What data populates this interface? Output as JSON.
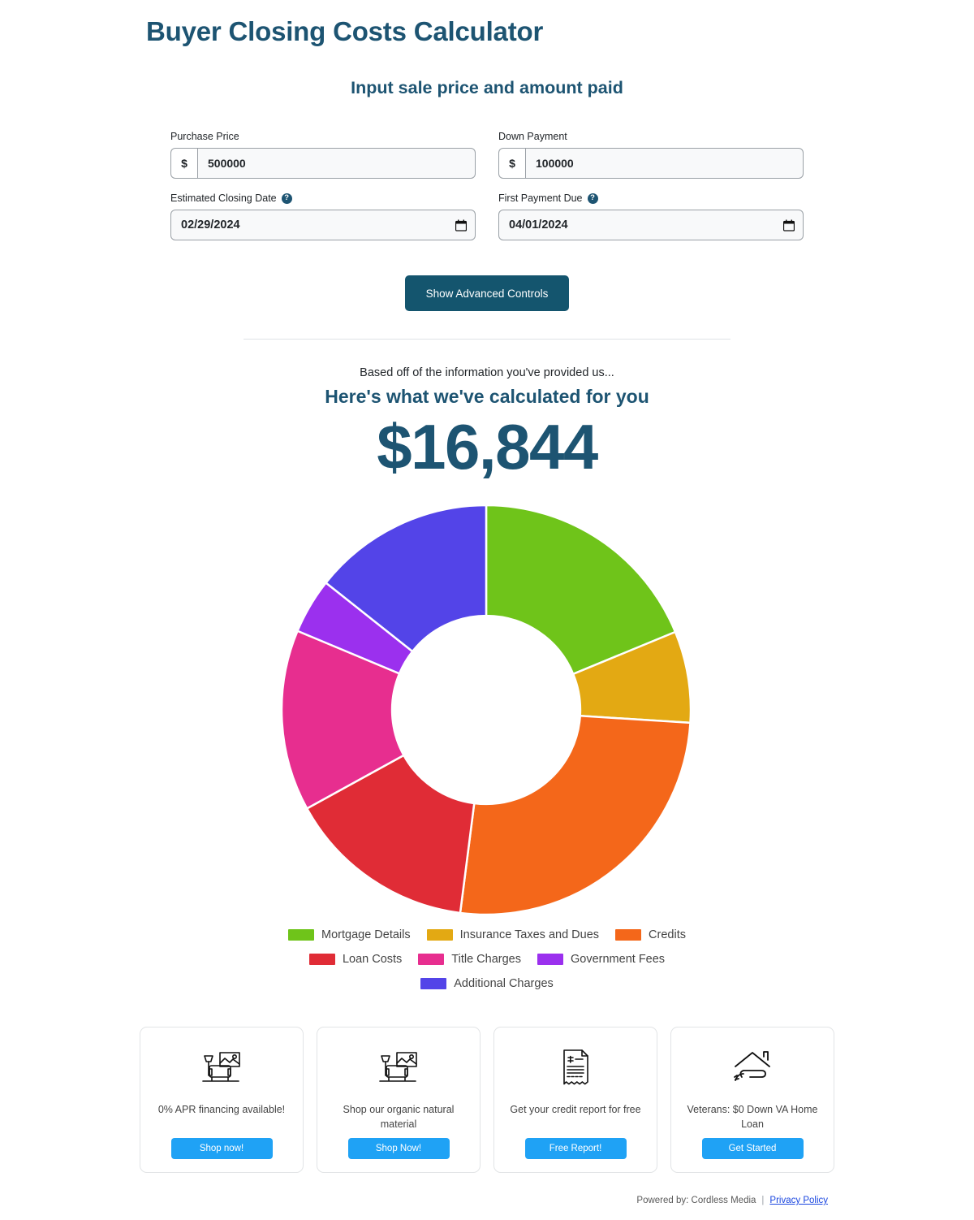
{
  "header": {
    "title": "Buyer Closing Costs Calculator",
    "subtitle": "Input sale price and amount paid"
  },
  "form": {
    "purchase_price": {
      "label": "Purchase Price",
      "prefix": "$",
      "value": "500000"
    },
    "down_payment": {
      "label": "Down Payment",
      "prefix": "$",
      "value": "100000"
    },
    "closing_date": {
      "label": "Estimated Closing Date",
      "help": "?",
      "value": "02/29/2024"
    },
    "first_payment": {
      "label": "First Payment Due",
      "help": "?",
      "value": "04/01/2024"
    },
    "advanced_button": "Show Advanced Controls"
  },
  "results": {
    "based_off": "Based off of the information you've provided us...",
    "calculated_heading": "Here's what we've calculated for you",
    "total": "$16,844"
  },
  "chart_data": {
    "type": "pie",
    "title": "",
    "variant": "donut",
    "start_angle_deg": 0,
    "direction": "clockwise",
    "inner_radius_ratio": 0.46,
    "legend_position": "bottom",
    "labels": [
      "Mortgage Details",
      "Insurance Taxes and Dues",
      "Credits",
      "Loan Costs",
      "Title Charges",
      "Government Fees",
      "Additional Charges"
    ],
    "colors": [
      "#6FC41A",
      "#E3A913",
      "#F4671A",
      "#E02C36",
      "#E72E8F",
      "#9B30EE",
      "#5344E8"
    ],
    "angles_deg": [
      67.6,
      26.0,
      93.7,
      53.9,
      51.5,
      15.7,
      51.6
    ],
    "percentages": [
      18.8,
      7.2,
      26.0,
      15.0,
      14.3,
      4.4,
      14.3
    ],
    "values": [
      3167,
      1213,
      4380,
      2527,
      2409,
      741,
      2413
    ],
    "total": 16844
  },
  "promos": [
    {
      "icon": "sofa-lamp-icon",
      "text": "0% APR financing available!",
      "button": "Shop now!"
    },
    {
      "icon": "sofa-lamp-icon",
      "text": "Shop our organic natural material",
      "button": "Shop Now!"
    },
    {
      "icon": "receipt-dollar-icon",
      "text": "Get your credit report for free",
      "button": "Free Report!"
    },
    {
      "icon": "house-in-hand-icon",
      "text": "Veterans: $0 Down VA Home Loan",
      "button": "Get Started"
    }
  ],
  "footer": {
    "powered_by": "Powered by: Cordless Media",
    "separator": "|",
    "privacy": "Privacy Policy"
  }
}
